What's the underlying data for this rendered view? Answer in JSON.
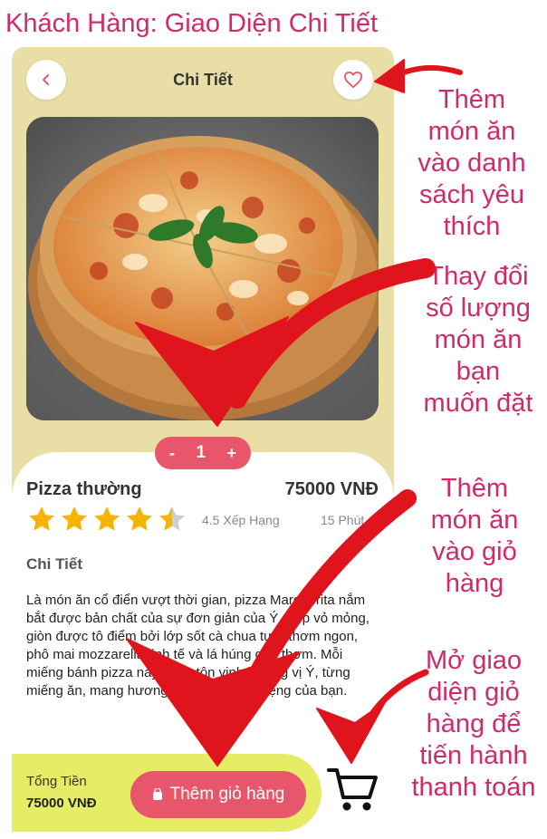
{
  "heading": "Khách Hàng: Giao Diện Chi Tiết",
  "header": {
    "title": "Chi Tiết"
  },
  "stepper": {
    "minus": "-",
    "quantity": "1",
    "plus": "+"
  },
  "product": {
    "name": "Pizza thường",
    "price": "75000 VNĐ",
    "rating_text": "4.5 Xếp Hạng",
    "rating": 4.5,
    "time": "15 Phút"
  },
  "details": {
    "title": "Chi Tiết",
    "description": "Là món ăn cổ điển vượt thời gian, pizza Margherita nắm bắt được bản chất của sự đơn giản của Ý. Lớp vỏ mỏng, giòn được tô điểm bởi lớp sốt cà chua tươi thơm ngon, phô mai mozzarella tinh tế và lá húng quế thơm. Mỗi miếng bánh pizza này là sự tôn vinh hương vị Ý, từng miếng ăn, mang hương vị Ý đến vòm miệng của bạn."
  },
  "bottom": {
    "total_label": "Tổng Tiền",
    "total_value": "75000 VNĐ",
    "add_button": "Thêm giỏ hàng"
  },
  "annotations": {
    "favorite": [
      "Thêm",
      "món ăn",
      "vào danh",
      "sách yêu",
      "thích"
    ],
    "quantity": [
      "Thay đổi",
      "số lượng",
      "món ăn",
      "bạn",
      "muốn đặt"
    ],
    "add_cart": [
      "Thêm",
      "món ăn",
      "vào giỏ",
      "hàng"
    ],
    "open_cart": [
      "Mở giao",
      "diện giỏ",
      "hàng để",
      "tiến hành",
      "thanh toán"
    ]
  },
  "colors": {
    "background": "#e8dea6",
    "accent": "#e8566b",
    "bottom_bar": "#e7ec67",
    "annotation": "#cf2a6a",
    "arrow": "#e0141c",
    "star": "#f5b400"
  },
  "icons": [
    "chevron-left-icon",
    "heart-icon",
    "star-icon",
    "bag-icon",
    "cart-icon"
  ]
}
